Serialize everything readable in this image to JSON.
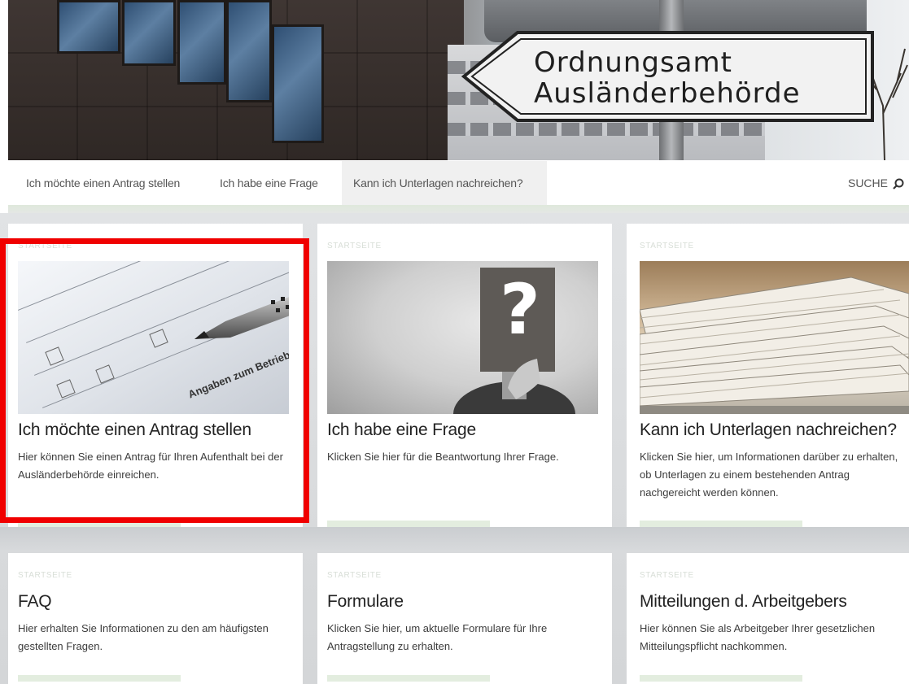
{
  "hero": {
    "sign_line1": "Ordnungsamt",
    "sign_line2": "Ausländerbehörde"
  },
  "nav": {
    "items": [
      "Ich möchte einen Antrag stellen",
      "Ich habe eine Frage",
      "Kann ich Unterlagen nachreichen?"
    ],
    "active_index": 2,
    "search_label": "SUCHE"
  },
  "cards": [
    {
      "kicker": "STARTSEITE",
      "title": "Ich möchte einen Antrag stellen",
      "text": "Hier können Sie einen Antrag für Ihren Aufenthalt bei der Ausländerbehörde einreichen.",
      "highlighted": true
    },
    {
      "kicker": "STARTSEITE",
      "title": "Ich habe eine Frage",
      "text": "Klicken Sie hier für die Beantwortung Ihrer Frage."
    },
    {
      "kicker": "STARTSEITE",
      "title": "Kann ich Unterlagen nachreichen?",
      "text": "Klicken Sie hier, um Informationen darüber zu erhalten, ob Unterlagen zu einem bestehenden Antrag nachgereicht werden können."
    },
    {
      "kicker": "STARTSEITE",
      "title": "FAQ",
      "text": "Hier erhalten Sie Informationen zu den am häufigsten gestellten Fragen."
    },
    {
      "kicker": "STARTSEITE",
      "title": "Formulare",
      "text": "Klicken Sie hier, um aktuelle Formulare für Ihre Antragstellung zu erhalten."
    },
    {
      "kicker": "STARTSEITE",
      "title": "Mitteilungen d. Arbeitgebers",
      "text": "Hier können Sie als Arbeitgeber Ihrer gesetzlichen Mitteilungspflicht nachkommen."
    }
  ],
  "images": {
    "card1_form_text": "Angaben zum Betrieb",
    "card2_symbol": "?"
  },
  "colors": {
    "highlight": "#f00000",
    "accent_green": "#e3eddf",
    "nav_active_bg": "#f0f0f0"
  }
}
